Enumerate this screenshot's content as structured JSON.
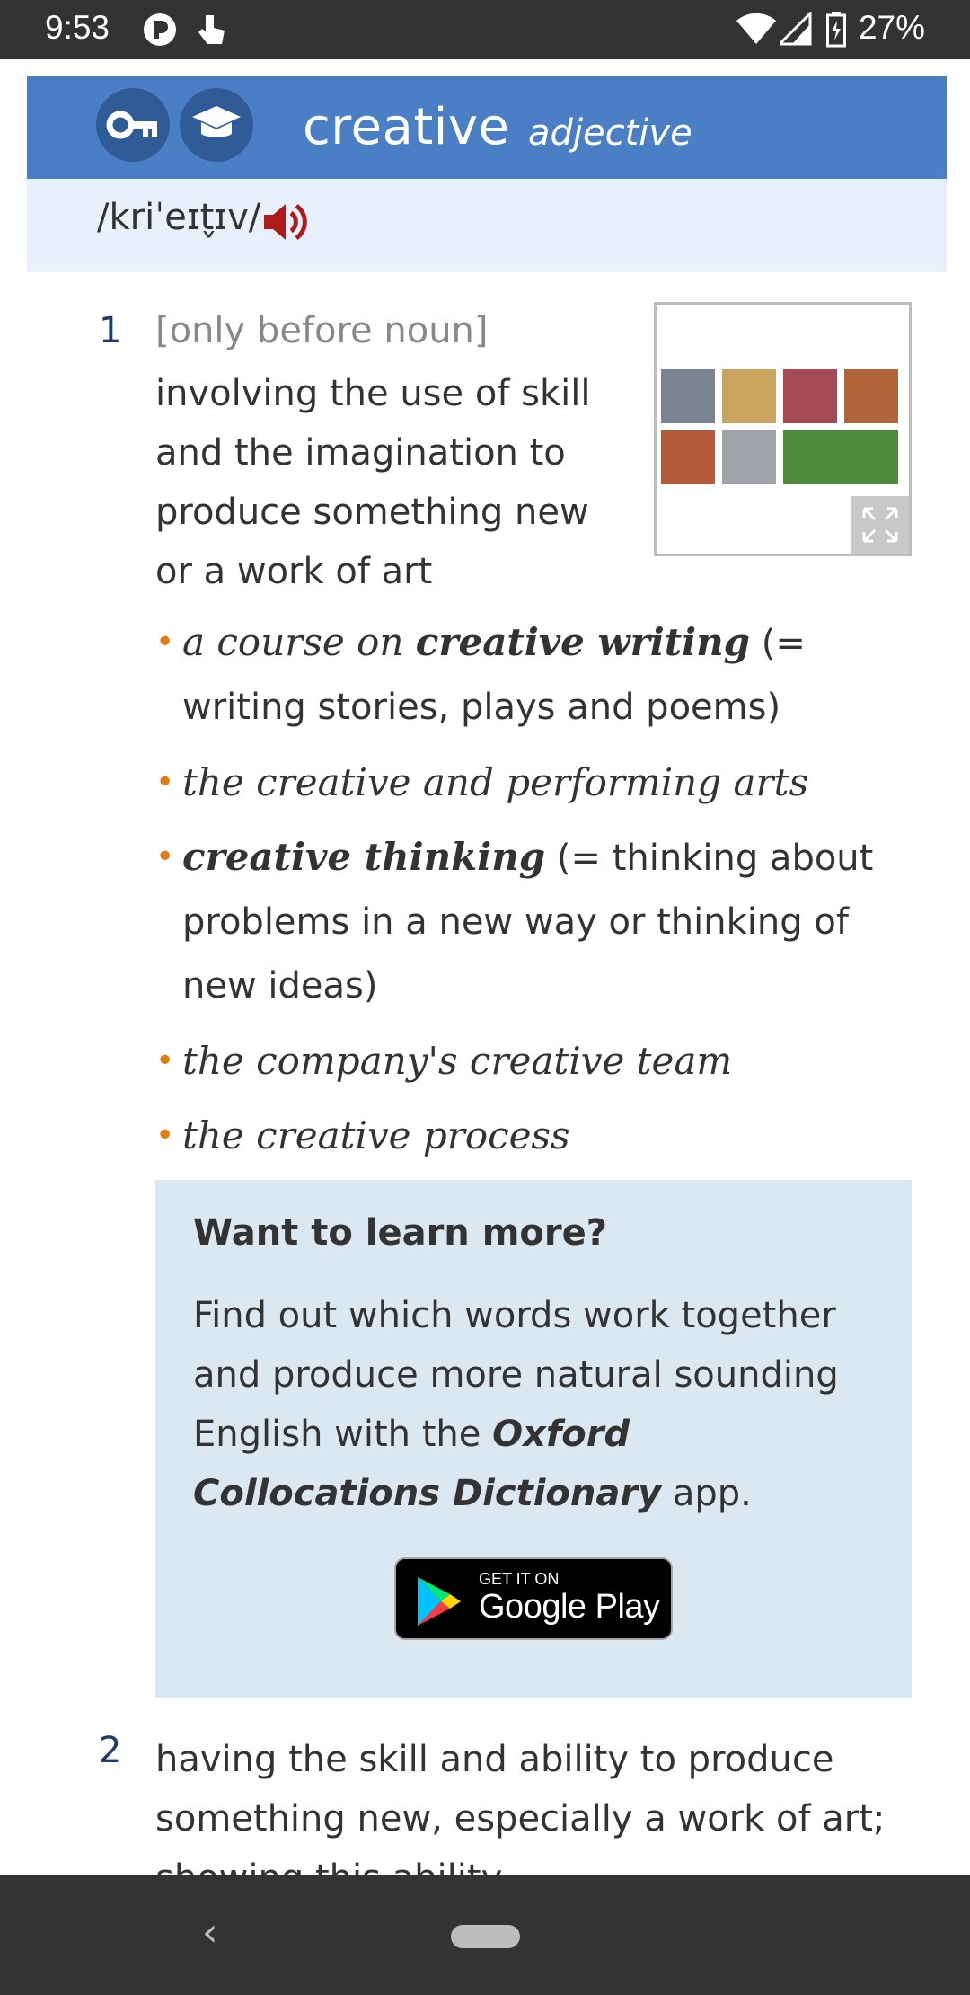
{
  "status_bar": {
    "time": "9:53",
    "battery": "27%",
    "icons": [
      "app-notification-icon",
      "touch-icon",
      "wifi-icon",
      "signal-icon",
      "battery-icon"
    ]
  },
  "entry": {
    "headword": "creative",
    "part_of_speech": "adjective",
    "pronunciation": "/kriˈeɪt̬ɪv/",
    "header_icons": [
      "oxford-3000-key-icon",
      "academic-cap-icon"
    ],
    "colors": {
      "header": "#4a7ec5",
      "pron_bar": "#e8f1fb",
      "bullet": "#e07d10",
      "speaker": "#b01b1b"
    }
  },
  "sense1": {
    "number": "1",
    "grammar": "[only before noun]",
    "definition": "involving the use of skill and the imagination to produce something new or a work of art",
    "examples": [
      {
        "parts": [
          {
            "t": "a course on ",
            "s": "it"
          },
          {
            "t": "creative writing",
            "s": "bold"
          },
          {
            "t": " (= writing stories, plays and poems)",
            "s": "gloss"
          }
        ]
      },
      {
        "parts": [
          {
            "t": "the creative and performing arts",
            "s": "it"
          }
        ]
      },
      {
        "parts": [
          {
            "t": "creative thinking",
            "s": "bold"
          },
          {
            "t": " (= thinking about problems in a new way or thinking of new ideas)",
            "s": "gloss"
          }
        ]
      },
      {
        "parts": [
          {
            "t": "the company's creative team",
            "s": "it"
          }
        ]
      },
      {
        "parts": [
          {
            "t": "the creative process",
            "s": "it"
          }
        ]
      }
    ]
  },
  "learn_more": {
    "title": "Want to learn more?",
    "text_before": "Find out which words work together and produce more natural sounding English with the ",
    "app_name": "Oxford Collocations Dictionary",
    "text_after": " app.",
    "badge_small": "GET IT ON",
    "badge_large": "Google Play"
  },
  "sense2": {
    "number": "2",
    "definition": "having the skill and ability to produce something new, especially a work of art; showing this ability"
  },
  "nav": {
    "back_glyph": "‹"
  }
}
